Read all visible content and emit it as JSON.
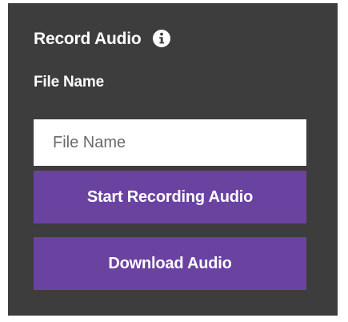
{
  "panel": {
    "title": "Record Audio",
    "info_icon": "info-circle-icon",
    "file_name_label": "File Name",
    "file_name_input": {
      "value": "",
      "placeholder": "File Name"
    },
    "start_button_label": "Start Recording Audio",
    "download_button_label": "Download Audio"
  },
  "colors": {
    "panel_background": "#3d3d3d",
    "button_background": "#6a43a0",
    "text": "#ffffff",
    "input_background": "#ffffff"
  }
}
